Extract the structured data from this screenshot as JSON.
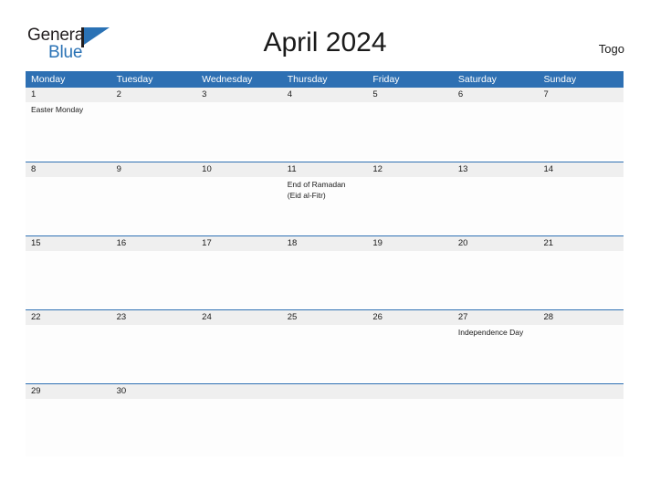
{
  "brand": {
    "word_one": "General",
    "word_two": "Blue",
    "flag_icon": "flag-triangle-icon"
  },
  "header": {
    "title": "April 2024",
    "country": "Togo"
  },
  "colors": {
    "header_blue": "#2e70b3",
    "daynum_band": "#efefef",
    "brand_blue": "#2a72b5",
    "text": "#1a1a1a"
  },
  "calendar": {
    "weekdays": [
      "Monday",
      "Tuesday",
      "Wednesday",
      "Thursday",
      "Friday",
      "Saturday",
      "Sunday"
    ],
    "weeks": [
      {
        "days": [
          {
            "number": "1",
            "events": [
              "Easter Monday"
            ]
          },
          {
            "number": "2",
            "events": []
          },
          {
            "number": "3",
            "events": []
          },
          {
            "number": "4",
            "events": []
          },
          {
            "number": "5",
            "events": []
          },
          {
            "number": "6",
            "events": []
          },
          {
            "number": "7",
            "events": []
          }
        ]
      },
      {
        "days": [
          {
            "number": "8",
            "events": []
          },
          {
            "number": "9",
            "events": []
          },
          {
            "number": "10",
            "events": []
          },
          {
            "number": "11",
            "events": [
              "End of Ramadan",
              "(Eid al-Fitr)"
            ]
          },
          {
            "number": "12",
            "events": []
          },
          {
            "number": "13",
            "events": []
          },
          {
            "number": "14",
            "events": []
          }
        ]
      },
      {
        "days": [
          {
            "number": "15",
            "events": []
          },
          {
            "number": "16",
            "events": []
          },
          {
            "number": "17",
            "events": []
          },
          {
            "number": "18",
            "events": []
          },
          {
            "number": "19",
            "events": []
          },
          {
            "number": "20",
            "events": []
          },
          {
            "number": "21",
            "events": []
          }
        ]
      },
      {
        "days": [
          {
            "number": "22",
            "events": []
          },
          {
            "number": "23",
            "events": []
          },
          {
            "number": "24",
            "events": []
          },
          {
            "number": "25",
            "events": []
          },
          {
            "number": "26",
            "events": []
          },
          {
            "number": "27",
            "events": [
              "Independence Day"
            ]
          },
          {
            "number": "28",
            "events": []
          }
        ]
      },
      {
        "days": [
          {
            "number": "29",
            "events": []
          },
          {
            "number": "30",
            "events": []
          },
          {
            "number": "",
            "events": []
          },
          {
            "number": "",
            "events": []
          },
          {
            "number": "",
            "events": []
          },
          {
            "number": "",
            "events": []
          },
          {
            "number": "",
            "events": []
          }
        ]
      }
    ]
  }
}
